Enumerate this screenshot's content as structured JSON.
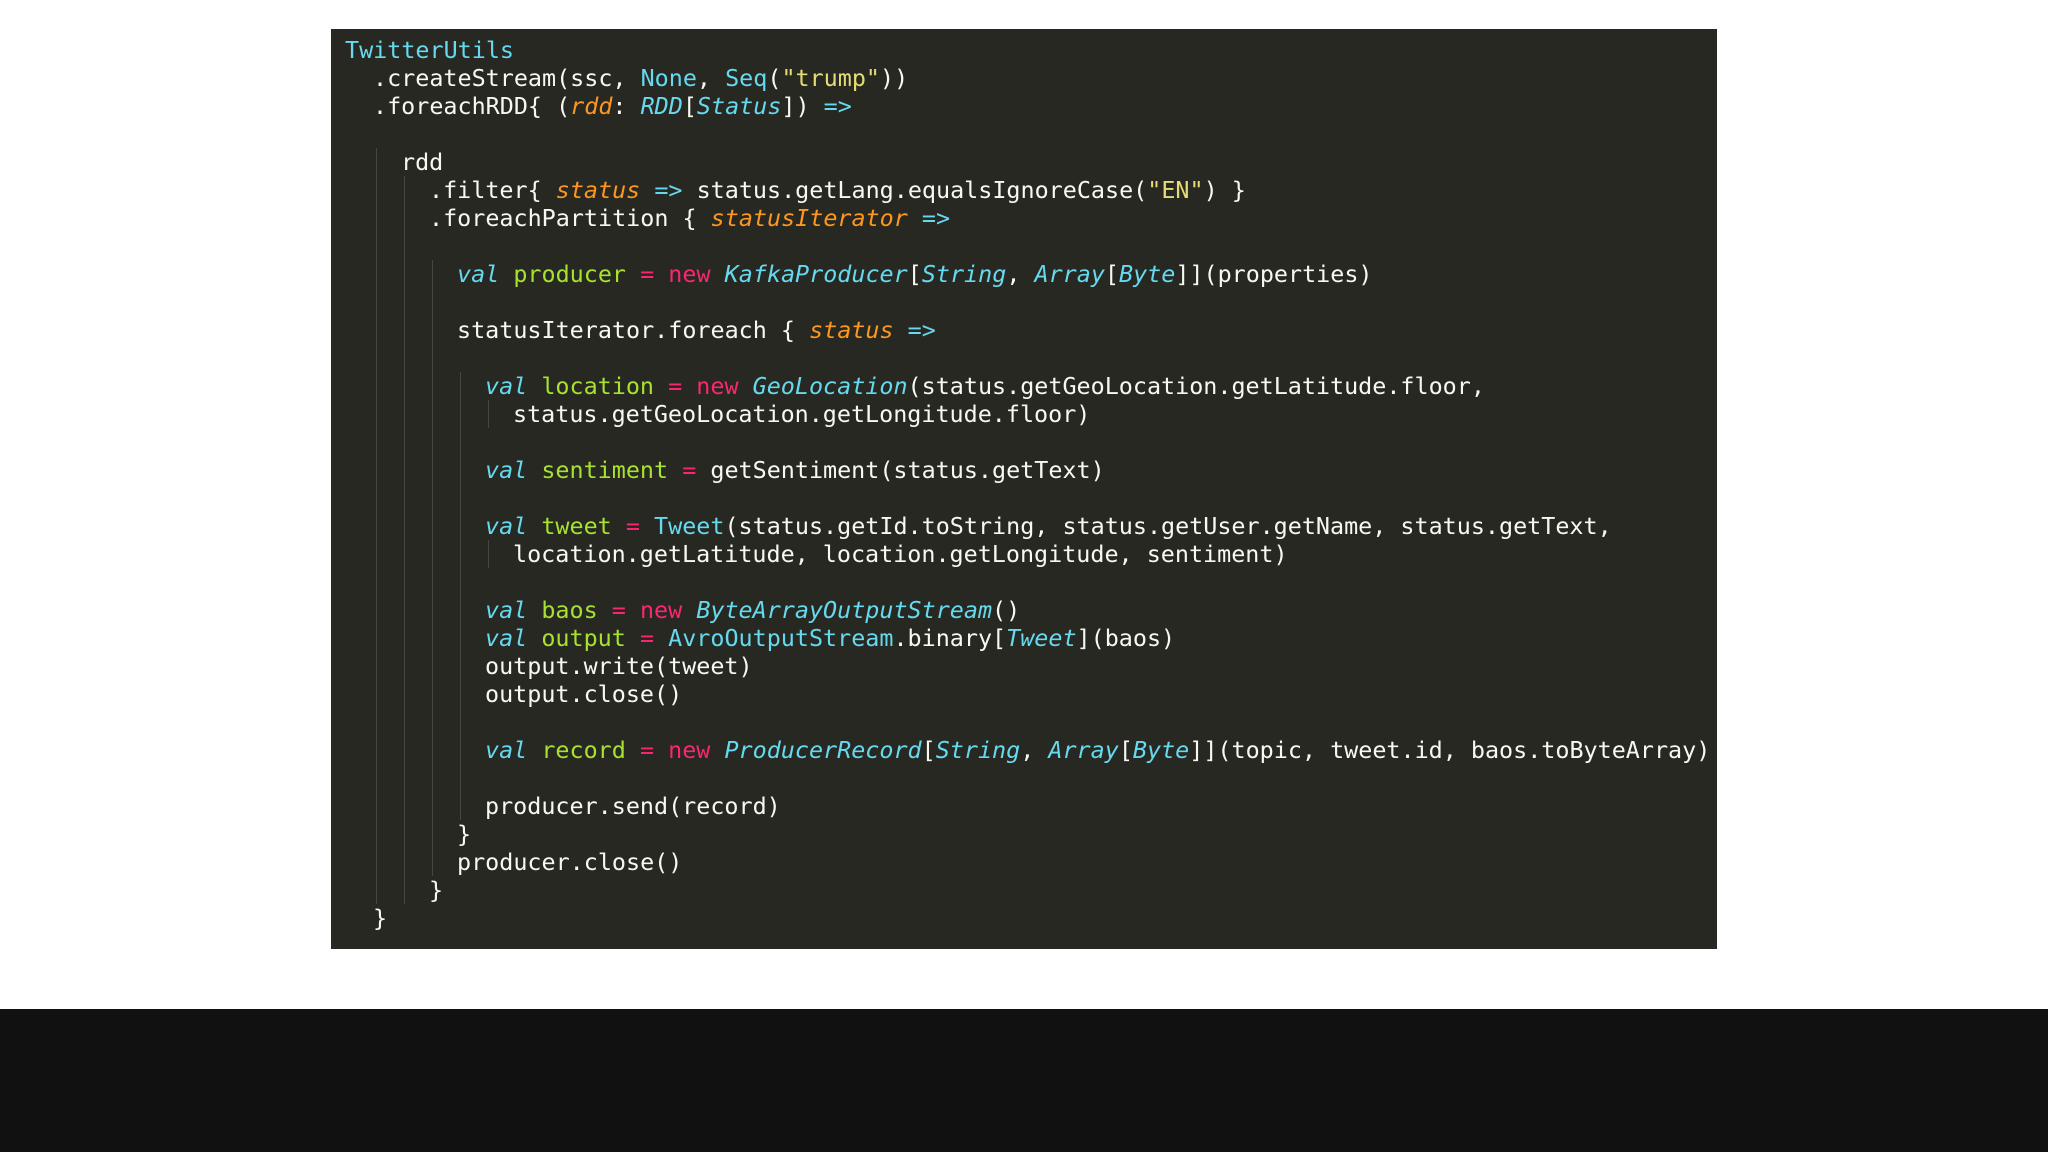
{
  "slide": {
    "background": "#ffffff",
    "code_background": "#272822",
    "bottom_bar_color": "#111111"
  },
  "code": {
    "language": "scala",
    "lines": [
      {
        "indent": 0,
        "tokens": [
          {
            "t": "TwitterUtils",
            "c": "type"
          }
        ]
      },
      {
        "indent": 1,
        "tokens": [
          {
            "t": ".createStream(ssc, ",
            "c": "plain"
          },
          {
            "t": "None",
            "c": "type"
          },
          {
            "t": ", ",
            "c": "plain"
          },
          {
            "t": "Seq",
            "c": "type"
          },
          {
            "t": "(",
            "c": "plain"
          },
          {
            "t": "\"trump\"",
            "c": "str"
          },
          {
            "t": "))",
            "c": "plain"
          }
        ]
      },
      {
        "indent": 1,
        "tokens": [
          {
            "t": ".foreachRDD{ (",
            "c": "plain"
          },
          {
            "t": "rdd",
            "c": "param"
          },
          {
            "t": ": ",
            "c": "plain"
          },
          {
            "t": "RDD",
            "c": "type-i"
          },
          {
            "t": "[",
            "c": "plain"
          },
          {
            "t": "Status",
            "c": "type-i"
          },
          {
            "t": "]) ",
            "c": "plain"
          },
          {
            "t": "=>",
            "c": "arrow"
          }
        ]
      },
      {
        "indent": 0,
        "tokens": []
      },
      {
        "indent": 2,
        "tokens": [
          {
            "t": "rdd",
            "c": "plain"
          }
        ]
      },
      {
        "indent": 3,
        "tokens": [
          {
            "t": ".filter{ ",
            "c": "plain"
          },
          {
            "t": "status",
            "c": "param"
          },
          {
            "t": " ",
            "c": "plain"
          },
          {
            "t": "=>",
            "c": "arrow"
          },
          {
            "t": " status.getLang.equalsIgnoreCase(",
            "c": "plain"
          },
          {
            "t": "\"EN\"",
            "c": "str"
          },
          {
            "t": ") }",
            "c": "plain"
          }
        ]
      },
      {
        "indent": 3,
        "tokens": [
          {
            "t": ".foreachPartition { ",
            "c": "plain"
          },
          {
            "t": "statusIterator",
            "c": "param"
          },
          {
            "t": " ",
            "c": "plain"
          },
          {
            "t": "=>",
            "c": "arrow"
          }
        ]
      },
      {
        "indent": 0,
        "tokens": []
      },
      {
        "indent": 4,
        "tokens": [
          {
            "t": "val",
            "c": "kw"
          },
          {
            "t": " ",
            "c": "plain"
          },
          {
            "t": "producer",
            "c": "name"
          },
          {
            "t": " ",
            "c": "plain"
          },
          {
            "t": "=",
            "c": "op"
          },
          {
            "t": " ",
            "c": "plain"
          },
          {
            "t": "new",
            "c": "new"
          },
          {
            "t": " ",
            "c": "plain"
          },
          {
            "t": "KafkaProducer",
            "c": "type-i"
          },
          {
            "t": "[",
            "c": "plain"
          },
          {
            "t": "String",
            "c": "type-i"
          },
          {
            "t": ", ",
            "c": "plain"
          },
          {
            "t": "Array",
            "c": "type-i"
          },
          {
            "t": "[",
            "c": "plain"
          },
          {
            "t": "Byte",
            "c": "type-i"
          },
          {
            "t": "]](properties)",
            "c": "plain"
          }
        ]
      },
      {
        "indent": 0,
        "tokens": []
      },
      {
        "indent": 4,
        "tokens": [
          {
            "t": "statusIterator.foreach { ",
            "c": "plain"
          },
          {
            "t": "status",
            "c": "param"
          },
          {
            "t": " ",
            "c": "plain"
          },
          {
            "t": "=>",
            "c": "arrow"
          }
        ]
      },
      {
        "indent": 0,
        "tokens": []
      },
      {
        "indent": 5,
        "tokens": [
          {
            "t": "val",
            "c": "kw"
          },
          {
            "t": " ",
            "c": "plain"
          },
          {
            "t": "location",
            "c": "name"
          },
          {
            "t": " ",
            "c": "plain"
          },
          {
            "t": "=",
            "c": "op"
          },
          {
            "t": " ",
            "c": "plain"
          },
          {
            "t": "new",
            "c": "new"
          },
          {
            "t": " ",
            "c": "plain"
          },
          {
            "t": "GeoLocation",
            "c": "type-i"
          },
          {
            "t": "(status.getGeoLocation.getLatitude.floor,",
            "c": "plain"
          }
        ]
      },
      {
        "indent": 6,
        "tokens": [
          {
            "t": "status.getGeoLocation.getLongitude.floor)",
            "c": "plain"
          }
        ]
      },
      {
        "indent": 0,
        "tokens": []
      },
      {
        "indent": 5,
        "tokens": [
          {
            "t": "val",
            "c": "kw"
          },
          {
            "t": " ",
            "c": "plain"
          },
          {
            "t": "sentiment",
            "c": "name"
          },
          {
            "t": " ",
            "c": "plain"
          },
          {
            "t": "=",
            "c": "op"
          },
          {
            "t": " getSentiment(status.getText)",
            "c": "plain"
          }
        ]
      },
      {
        "indent": 0,
        "tokens": []
      },
      {
        "indent": 5,
        "tokens": [
          {
            "t": "val",
            "c": "kw"
          },
          {
            "t": " ",
            "c": "plain"
          },
          {
            "t": "tweet",
            "c": "name"
          },
          {
            "t": " ",
            "c": "plain"
          },
          {
            "t": "=",
            "c": "op"
          },
          {
            "t": " ",
            "c": "plain"
          },
          {
            "t": "Tweet",
            "c": "type"
          },
          {
            "t": "(status.getId.toString, status.getUser.getName, status.getText,",
            "c": "plain"
          }
        ]
      },
      {
        "indent": 6,
        "tokens": [
          {
            "t": "location.getLatitude, location.getLongitude, sentiment)",
            "c": "plain"
          }
        ]
      },
      {
        "indent": 0,
        "tokens": []
      },
      {
        "indent": 5,
        "tokens": [
          {
            "t": "val",
            "c": "kw"
          },
          {
            "t": " ",
            "c": "plain"
          },
          {
            "t": "baos",
            "c": "name"
          },
          {
            "t": " ",
            "c": "plain"
          },
          {
            "t": "=",
            "c": "op"
          },
          {
            "t": " ",
            "c": "plain"
          },
          {
            "t": "new",
            "c": "new"
          },
          {
            "t": " ",
            "c": "plain"
          },
          {
            "t": "ByteArrayOutputStream",
            "c": "type-i"
          },
          {
            "t": "()",
            "c": "plain"
          }
        ]
      },
      {
        "indent": 5,
        "tokens": [
          {
            "t": "val",
            "c": "kw"
          },
          {
            "t": " ",
            "c": "plain"
          },
          {
            "t": "output",
            "c": "name"
          },
          {
            "t": " ",
            "c": "plain"
          },
          {
            "t": "=",
            "c": "op"
          },
          {
            "t": " ",
            "c": "plain"
          },
          {
            "t": "AvroOutputStream",
            "c": "type"
          },
          {
            "t": ".binary[",
            "c": "plain"
          },
          {
            "t": "Tweet",
            "c": "type-i"
          },
          {
            "t": "](baos)",
            "c": "plain"
          }
        ]
      },
      {
        "indent": 5,
        "tokens": [
          {
            "t": "output.write(tweet)",
            "c": "plain"
          }
        ]
      },
      {
        "indent": 5,
        "tokens": [
          {
            "t": "output.close()",
            "c": "plain"
          }
        ]
      },
      {
        "indent": 0,
        "tokens": []
      },
      {
        "indent": 5,
        "tokens": [
          {
            "t": "val",
            "c": "kw"
          },
          {
            "t": " ",
            "c": "plain"
          },
          {
            "t": "record",
            "c": "name"
          },
          {
            "t": " ",
            "c": "plain"
          },
          {
            "t": "=",
            "c": "op"
          },
          {
            "t": " ",
            "c": "plain"
          },
          {
            "t": "new",
            "c": "new"
          },
          {
            "t": " ",
            "c": "plain"
          },
          {
            "t": "ProducerRecord",
            "c": "type-i"
          },
          {
            "t": "[",
            "c": "plain"
          },
          {
            "t": "String",
            "c": "type-i"
          },
          {
            "t": ", ",
            "c": "plain"
          },
          {
            "t": "Array",
            "c": "type-i"
          },
          {
            "t": "[",
            "c": "plain"
          },
          {
            "t": "Byte",
            "c": "type-i"
          },
          {
            "t": "]](topic, tweet.id, baos.toByteArray)",
            "c": "plain"
          }
        ]
      },
      {
        "indent": 0,
        "tokens": []
      },
      {
        "indent": 5,
        "tokens": [
          {
            "t": "producer.send(record)",
            "c": "plain"
          }
        ]
      },
      {
        "indent": 4,
        "tokens": [
          {
            "t": "}",
            "c": "plain"
          }
        ]
      },
      {
        "indent": 4,
        "tokens": [
          {
            "t": "producer.close()",
            "c": "plain"
          }
        ]
      },
      {
        "indent": 3,
        "tokens": [
          {
            "t": "}",
            "c": "plain"
          }
        ]
      },
      {
        "indent": 1,
        "tokens": [
          {
            "t": "}",
            "c": "plain"
          }
        ]
      }
    ]
  }
}
